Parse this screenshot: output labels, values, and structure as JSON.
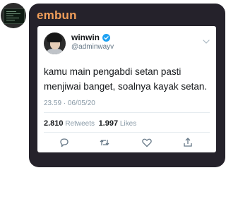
{
  "chat": {
    "sender_name": "embun",
    "sender_avatar_icon": "computer-screen-avatar"
  },
  "tweet": {
    "author_name": "winwin",
    "author_handle": "@adminwayv",
    "text_lines": [
      "kamu main pengabdi setan pasti",
      "menjiwai banget, soalnya kayak setan."
    ],
    "timestamp": "23.59 · 06/05/20",
    "retweets_count": "2.810",
    "retweets_label": "Retweets",
    "likes_count": "1.997",
    "likes_label": "Likes",
    "actions": [
      "reply-icon",
      "retweet-icon",
      "like-icon",
      "share-icon"
    ]
  },
  "colors": {
    "bubble_bg": "#25222b",
    "sender_name": "#f29f5a",
    "verified_badge": "#1da1f2",
    "muted_text": "#8899a6"
  }
}
